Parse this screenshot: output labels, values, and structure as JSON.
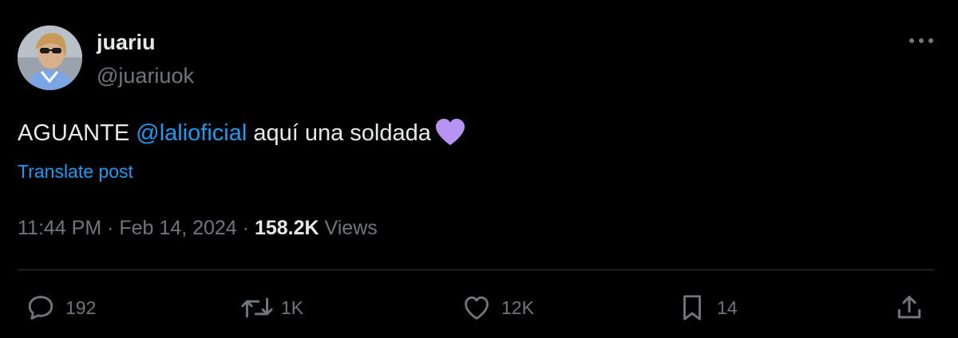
{
  "author": {
    "display_name": "juariu",
    "handle": "@juariuok"
  },
  "tweet": {
    "text_before": "AGUANTE ",
    "mention": "@lalioficial",
    "text_after": " aquí una soldada",
    "emoji": "purple-heart",
    "translate_label": "Translate post"
  },
  "meta": {
    "time": "11:44 PM",
    "separator": " · ",
    "date": "Feb 14, 2024",
    "views_count": "158.2K",
    "views_label": " Views"
  },
  "actions": {
    "replies": "192",
    "reposts": "1K",
    "likes": "12K",
    "bookmarks": "14"
  },
  "colors": {
    "background": "#000000",
    "text": "#e7e9ea",
    "secondary": "#71767b",
    "accent": "#1d9bf0",
    "emoji_heart": "#b794f4"
  }
}
